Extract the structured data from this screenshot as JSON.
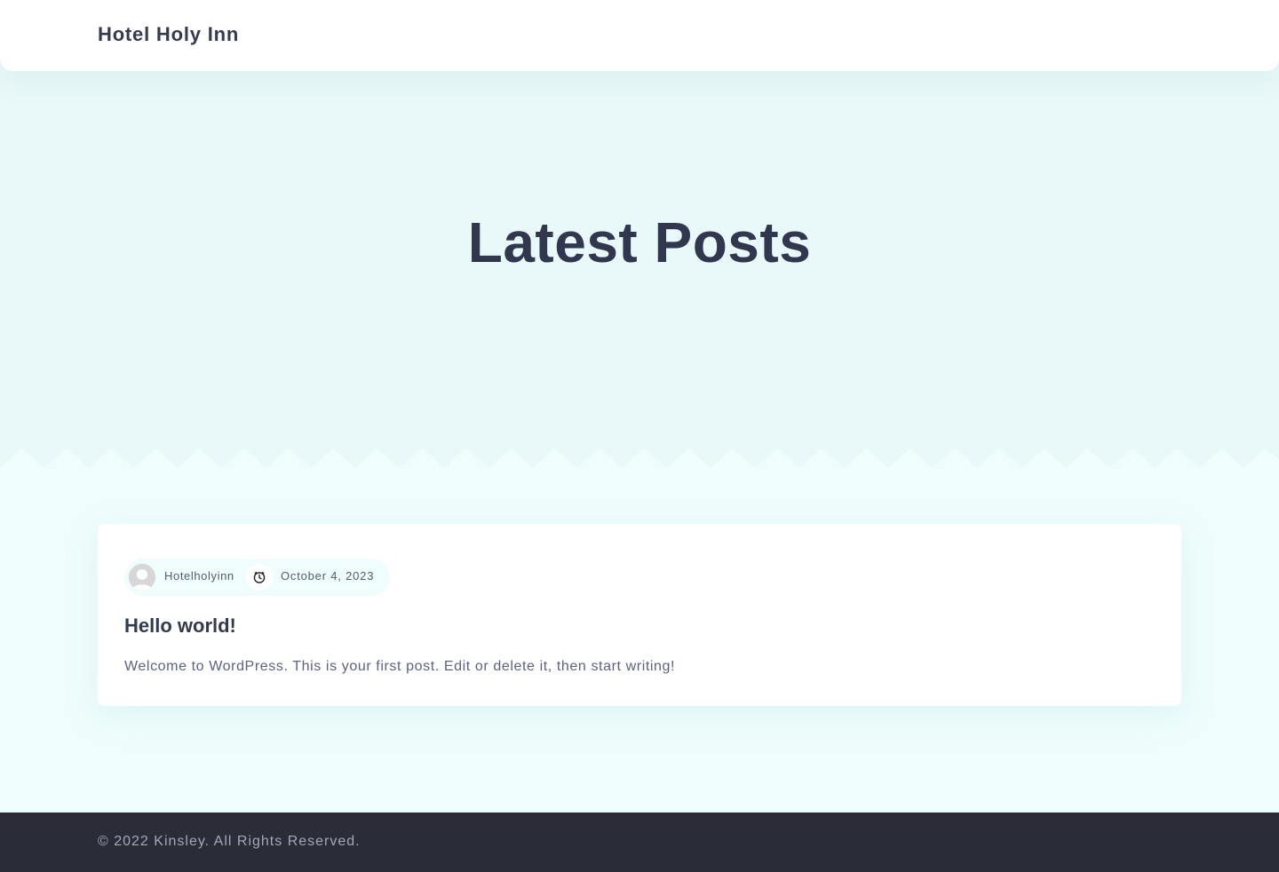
{
  "header": {
    "site_title": "Hotel Holy Inn"
  },
  "hero": {
    "title": "Latest Posts"
  },
  "post": {
    "author": "Hotelholyinn",
    "date": "October 4, 2023",
    "title": "Hello world!",
    "excerpt": "Welcome to WordPress. This is your first post. Edit or delete it, then start writing!"
  },
  "footer": {
    "copyright": "© 2022 Kinsley. All Rights Reserved."
  },
  "colors": {
    "hero_bg": "#e9f8f8",
    "page_bg": "#f0fdfd",
    "heading": "#323750",
    "footer_bg": "#2a2d38",
    "footer_text": "#a3a7b8"
  },
  "icons": {
    "avatar": "avatar-icon",
    "date": "clock-icon"
  }
}
